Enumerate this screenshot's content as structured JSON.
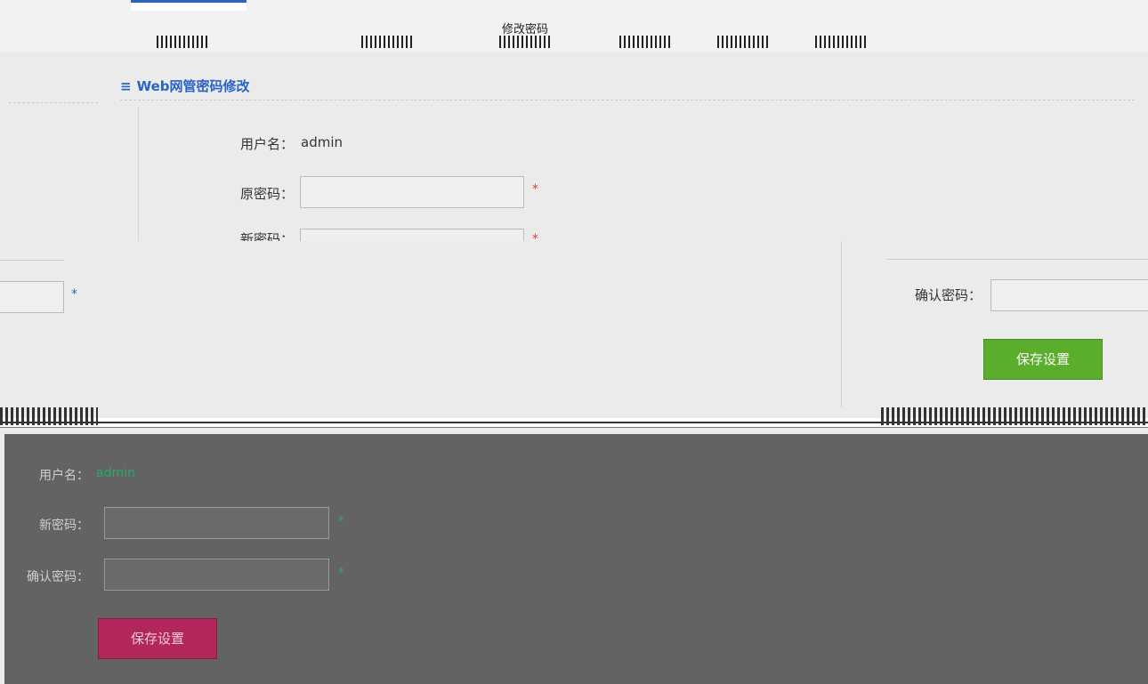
{
  "nav": {
    "tabs": [
      {
        "label": "",
        "active": false
      },
      {
        "label": "",
        "active": false
      },
      {
        "label": "",
        "active": false
      },
      {
        "label": "修改密码",
        "active": true
      },
      {
        "label": "",
        "active": false
      },
      {
        "label": "",
        "active": false
      },
      {
        "label": "",
        "active": false
      }
    ]
  },
  "section": {
    "icon": "list-icon",
    "title": "Web网管密码修改"
  },
  "form": {
    "username_label": "用户名：",
    "username_value": "admin",
    "old_password_label": "原密码：",
    "new_password_label": "新密码：",
    "confirm_password_label": "确认密码：",
    "required_mark": "*",
    "save_label": "保存设置"
  },
  "colors": {
    "accent": "#2a63c6",
    "required": "#d9413a",
    "save_green": "#5aae2b",
    "save_pink": "#b1275c",
    "dark_panel": "#636363"
  }
}
